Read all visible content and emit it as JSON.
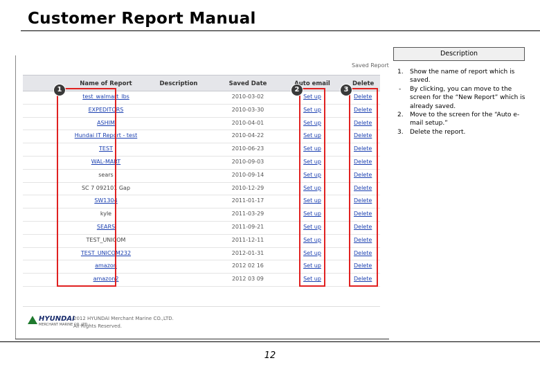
{
  "page": {
    "title": "Customer Report Manual",
    "page_number": "12"
  },
  "screenshot": {
    "saved_report_label": "Saved Report",
    "columns": [
      "Name of Report",
      "Description",
      "Saved Date",
      "Auto email",
      "Delete"
    ],
    "rows": [
      {
        "name": "test_walmart_lbs",
        "date": "2010-03-02",
        "auto": "Set up",
        "del": "Delete",
        "link": true
      },
      {
        "name": "EXPEDITORS",
        "date": "2010-03-30",
        "auto": "Set up",
        "del": "Delete",
        "link": true
      },
      {
        "name": "ASHIM",
        "date": "2010-04-01",
        "auto": "Set up",
        "del": "Delete",
        "link": true
      },
      {
        "name": "Hundai IT Report - test",
        "date": "2010-04-22",
        "auto": "Set up",
        "del": "Delete",
        "link": true
      },
      {
        "name": "TEST",
        "date": "2010-06-23",
        "auto": "Set up",
        "del": "Delete",
        "link": true
      },
      {
        "name": "WAL-MART",
        "date": "2010-09-03",
        "auto": "Set up",
        "del": "Delete",
        "link": true
      },
      {
        "name": "sears",
        "date": "2010-09-14",
        "auto": "Set up",
        "del": "Delete",
        "link": false
      },
      {
        "name": "SC 7 092101 Gap",
        "date": "2010-12-29",
        "auto": "Set up",
        "del": "Delete",
        "link": false
      },
      {
        "name": "SW1304",
        "date": "2011-01-17",
        "auto": "Set up",
        "del": "Delete",
        "link": true
      },
      {
        "name": "kyle",
        "date": "2011-03-29",
        "auto": "Set up",
        "del": "Delete",
        "link": false
      },
      {
        "name": "SEARS",
        "date": "2011-09-21",
        "auto": "Set up",
        "del": "Delete",
        "link": true
      },
      {
        "name": "TEST_UNICOM",
        "date": "2011-12-11",
        "auto": "Set up",
        "del": "Delete",
        "link": false
      },
      {
        "name": "TEST_UNICOM232",
        "date": "2012-01-31",
        "auto": "Set up",
        "del": "Delete",
        "link": true
      },
      {
        "name": "amazon",
        "date": "2012 02 16",
        "auto": "Set up",
        "del": "Delete",
        "link": true
      },
      {
        "name": "amazon2",
        "date": "2012 03 09",
        "auto": "Set up",
        "del": "Delete",
        "link": true
      }
    ],
    "badges": [
      "1",
      "2",
      "3"
    ],
    "footer": {
      "brand": "HYUNDAI",
      "brand_sub": "MERCHANT MARINE CO.,LTD.",
      "copyright": "2012 HYUNDAI Merchant Marine CO.,LTD.",
      "rights": "All Rights Reserved."
    }
  },
  "description": {
    "header": "Description",
    "items": [
      {
        "mark": "1.",
        "text": "Show the name of report which is saved."
      },
      {
        "mark": "-",
        "text": "By clicking, you can move to the screen for the “New Report” which is already saved."
      },
      {
        "mark": "2.",
        "text": "Move to the screen for the “Auto e-mail setup.”"
      },
      {
        "mark": "3.",
        "text": "Delete the report."
      }
    ]
  },
  "colors": {
    "highlight": "#e02020",
    "link": "#1a3fb0",
    "header_bg": "#e5e6ea"
  }
}
